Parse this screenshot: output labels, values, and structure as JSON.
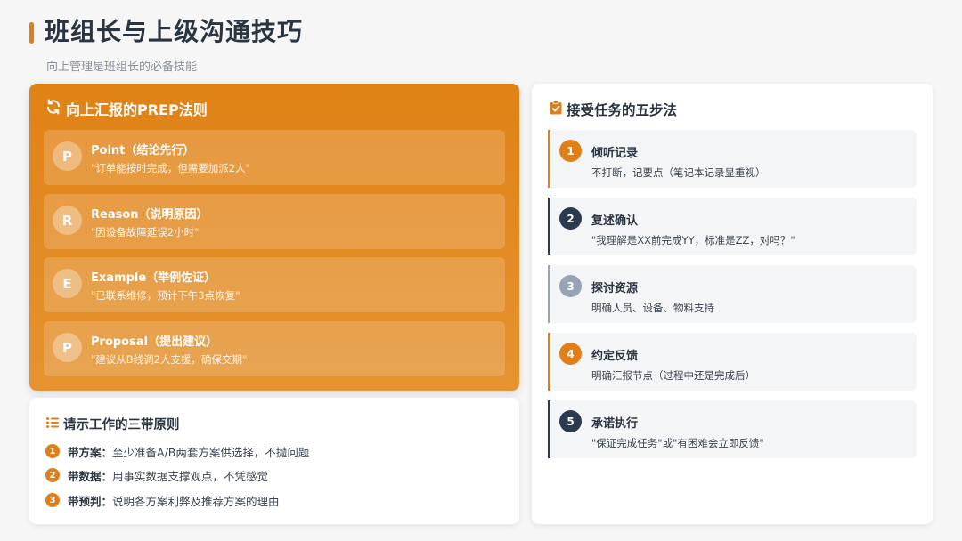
{
  "header": {
    "title": "班组长与上级沟通技巧",
    "subtitle": "向上管理是班组长的必备技能"
  },
  "prep": {
    "heading": "向上汇报的PREP法则",
    "icon": "refresh-icon",
    "items": [
      {
        "letter": "P",
        "name": "Point（结论先行）",
        "desc": "\"订单能按时完成，但需要加派2人\""
      },
      {
        "letter": "R",
        "name": "Reason（说明原因）",
        "desc": "\"因设备故障延误2小时\""
      },
      {
        "letter": "E",
        "name": "Example（举例佐证）",
        "desc": "\"已联系维修，预计下午3点恢复\""
      },
      {
        "letter": "P",
        "name": "Proposal（提出建议）",
        "desc": "\"建议从B线调2人支援，确保交期\""
      }
    ]
  },
  "bands": {
    "heading": "请示工作的三带原则",
    "icon": "list-icon",
    "items": [
      {
        "num": "1",
        "key": "带方案：",
        "text": "至少准备A/B两套方案供选择，不抛问题"
      },
      {
        "num": "2",
        "key": "带数据：",
        "text": "用事实数据支撑观点，不凭感觉"
      },
      {
        "num": "3",
        "key": "带预判：",
        "text": "说明各方案利弊及推荐方案的理由"
      }
    ]
  },
  "steps": {
    "heading": "接受任务的五步法",
    "icon": "clipboard-check-icon",
    "items": [
      {
        "num": "1",
        "title": "倾听记录",
        "desc": "不打断，记要点（笔记本记录显重视）",
        "color": "#e07f1a"
      },
      {
        "num": "2",
        "title": "复述确认",
        "desc": "\"我理解是XX前完成YY，标准是ZZ，对吗？\"",
        "color": "#2b3a4e"
      },
      {
        "num": "3",
        "title": "探讨资源",
        "desc": "明确人员、设备、物料支持",
        "color": "#98a3b3"
      },
      {
        "num": "4",
        "title": "约定反馈",
        "desc": "明确汇报节点（过程中还是完成后）",
        "color": "#e07f1a"
      },
      {
        "num": "5",
        "title": "承诺执行",
        "desc": "\"保证完成任务\"或\"有困难会立即反馈\"",
        "color": "#2b3a4e"
      }
    ]
  },
  "colors": {
    "accent": "#e07f1a",
    "navy": "#2b3a4e",
    "gray": "#98a3b3"
  }
}
